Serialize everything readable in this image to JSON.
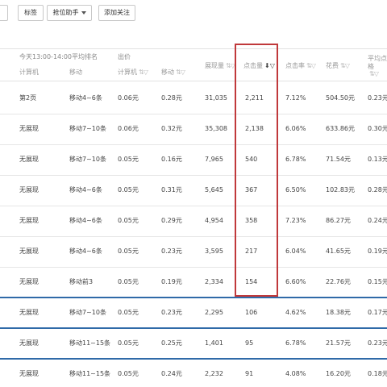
{
  "toolbar": {
    "buttons": [
      {
        "label": ""
      },
      {
        "label": "标签"
      },
      {
        "label": "抢位助手"
      },
      {
        "label": "添加关注"
      }
    ]
  },
  "table": {
    "group_headers": {
      "rank_period": "今天13:00-14:00平均排名",
      "bid": "出价"
    },
    "columns": {
      "pc_rank": "计算机",
      "mobile_rank": "移动",
      "pc_bid": "计算机",
      "mobile_bid": "移动",
      "impressions": "展现量",
      "clicks": "点击量",
      "ctr": "点击率",
      "cost": "花费",
      "avg_cpc": "平均点击价格"
    },
    "rows": [
      {
        "pc_rank": "第2页",
        "mobile_rank": "移动4~6条",
        "pc_bid": "0.06元",
        "mobile_bid": "0.28元",
        "impressions": "31,035",
        "clicks": "2,211",
        "ctr": "7.12%",
        "cost": "504.50元",
        "avg_cpc": "0.23元"
      },
      {
        "pc_rank": "无展现",
        "mobile_rank": "移动7~10条",
        "pc_bid": "0.06元",
        "mobile_bid": "0.32元",
        "impressions": "35,308",
        "clicks": "2,138",
        "ctr": "6.06%",
        "cost": "633.86元",
        "avg_cpc": "0.30元"
      },
      {
        "pc_rank": "无展现",
        "mobile_rank": "移动7~10条",
        "pc_bid": "0.05元",
        "mobile_bid": "0.16元",
        "impressions": "7,965",
        "clicks": "540",
        "ctr": "6.78%",
        "cost": "71.54元",
        "avg_cpc": "0.13元"
      },
      {
        "pc_rank": "无展现",
        "mobile_rank": "移动4~6条",
        "pc_bid": "0.05元",
        "mobile_bid": "0.31元",
        "impressions": "5,645",
        "clicks": "367",
        "ctr": "6.50%",
        "cost": "102.83元",
        "avg_cpc": "0.28元"
      },
      {
        "pc_rank": "无展现",
        "mobile_rank": "移动4~6条",
        "pc_bid": "0.05元",
        "mobile_bid": "0.29元",
        "impressions": "4,954",
        "clicks": "358",
        "ctr": "7.23%",
        "cost": "86.27元",
        "avg_cpc": "0.24元"
      },
      {
        "pc_rank": "无展现",
        "mobile_rank": "移动4~6条",
        "pc_bid": "0.05元",
        "mobile_bid": "0.23元",
        "impressions": "3,595",
        "clicks": "217",
        "ctr": "6.04%",
        "cost": "41.65元",
        "avg_cpc": "0.19元"
      },
      {
        "pc_rank": "无展现",
        "mobile_rank": "移动前3",
        "pc_bid": "0.05元",
        "mobile_bid": "0.19元",
        "impressions": "2,334",
        "clicks": "154",
        "ctr": "6.60%",
        "cost": "22.76元",
        "avg_cpc": "0.15元"
      },
      {
        "pc_rank": "无展现",
        "mobile_rank": "移动7~10条",
        "pc_bid": "0.05元",
        "mobile_bid": "0.23元",
        "impressions": "2,295",
        "clicks": "106",
        "ctr": "4.62%",
        "cost": "18.38元",
        "avg_cpc": "0.17元"
      },
      {
        "pc_rank": "无展现",
        "mobile_rank": "移动11~15条",
        "pc_bid": "0.05元",
        "mobile_bid": "0.25元",
        "impressions": "1,401",
        "clicks": "95",
        "ctr": "6.78%",
        "cost": "21.57元",
        "avg_cpc": "0.23元"
      },
      {
        "pc_rank": "无展现",
        "mobile_rank": "移动11~15条",
        "pc_bid": "0.05元",
        "mobile_bid": "0.24元",
        "impressions": "2,232",
        "clicks": "91",
        "ctr": "4.08%",
        "cost": "16.20元",
        "avg_cpc": "0.18元"
      }
    ]
  },
  "colors": {
    "highlight_box": "#c0393b",
    "row_separator_blue": "#2f6aa8",
    "header_text": "#999999"
  },
  "icons": {
    "sort_default": "⇅▽",
    "sort_desc_active": "⬇▽"
  }
}
